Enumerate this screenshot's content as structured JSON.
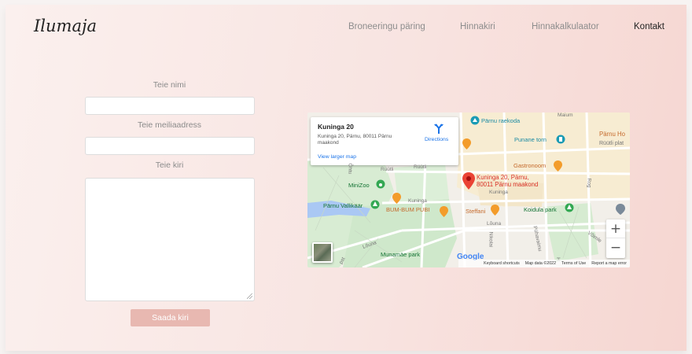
{
  "brand": {
    "logo": "Ilumaja"
  },
  "nav": [
    {
      "label": "Broneeringu päring",
      "active": false
    },
    {
      "label": "Hinnakiri",
      "active": false
    },
    {
      "label": "Hinnakalkulaator",
      "active": false
    },
    {
      "label": "Kontakt",
      "active": true
    }
  ],
  "form": {
    "name_label": "Teie nimi",
    "email_label": "Teie meiliaadress",
    "message_label": "Teie kiri",
    "name_value": "",
    "email_value": "",
    "message_value": "",
    "submit_label": "Saada kiri"
  },
  "map": {
    "card": {
      "name": "Kuninga 20",
      "address": "Kuninga 20, Pärnu, 80011 Pärnu maakond",
      "larger_map": "View larger map",
      "directions": "Directions"
    },
    "labels": {
      "raekoda": "Pärnu raekoda",
      "punane_torn": "Punane torn",
      "parnu_ho": "Pärnu Ho",
      "ruutli_plat": "Rüütli plat",
      "gastronoom": "Gastronoom",
      "marker": "Kuninga 20, Pärnu, 80011 Pärnu maakond",
      "minizoo": "MiniZoo",
      "vallikaar": "Pärnu Vallikäär",
      "bumbum": "BUM-BUM PUBI",
      "steffani": "Steffani",
      "koidula": "Koidula park",
      "munamae": "Munamäe park",
      "kuninga_street": "Kuninga",
      "kuninga_street2": "Kuninga",
      "ruutli1": "Rüütli",
      "ruutli2": "Rüütli",
      "louna": "Lõuna",
      "louna2": "Lõuna",
      "nikolai": "Nikolai",
      "puhavaimu": "Pühavaimu",
      "voimle": "Võimle",
      "maium": "Maium",
      "rogi": "Rog",
      "hom": "H",
      "ohtu": "Õhtu",
      "park_pst": "pst"
    },
    "google": "Google",
    "attribution": {
      "shortcuts": "Keyboard shortcuts",
      "data": "Map data ©2022",
      "terms": "Terms of Use",
      "report": "Report a map error"
    },
    "zoom_in": "+",
    "zoom_out": "−"
  }
}
